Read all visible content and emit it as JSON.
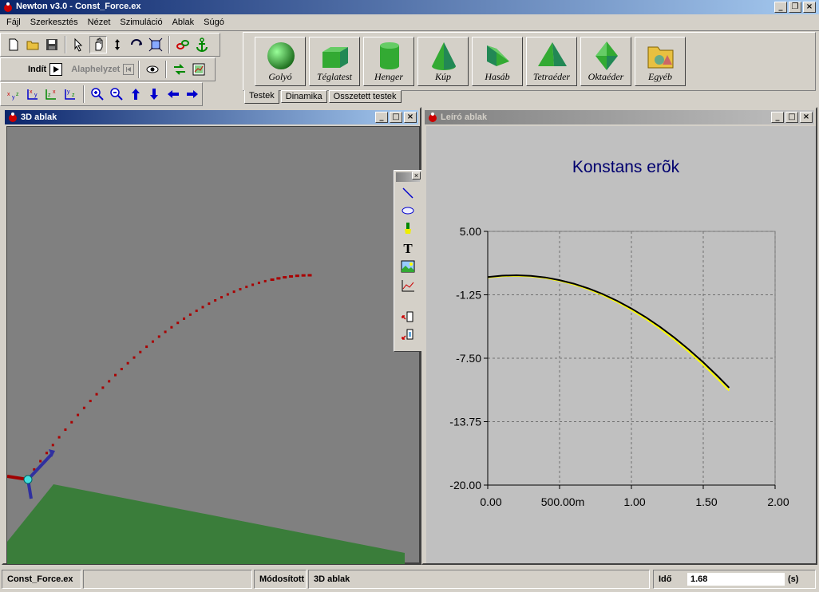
{
  "window": {
    "title": "Newton v3.0 - Const_Force.ex"
  },
  "menu": [
    "Fájl",
    "Szerkesztés",
    "Nézet",
    "Szimuláció",
    "Ablak",
    "Súgó"
  ],
  "toolbar": {
    "start_label": "Indít",
    "reset_label": "Alaphelyzet"
  },
  "palette": {
    "items": [
      {
        "label": "Golyó",
        "icon": "sphere-icon"
      },
      {
        "label": "Téglatest",
        "icon": "box-icon"
      },
      {
        "label": "Henger",
        "icon": "cylinder-icon"
      },
      {
        "label": "Kúp",
        "icon": "cone-icon"
      },
      {
        "label": "Hasáb",
        "icon": "prism-icon"
      },
      {
        "label": "Tetraéder",
        "icon": "tetrahedron-icon"
      },
      {
        "label": "Oktaéder",
        "icon": "octahedron-icon"
      },
      {
        "label": "Egyéb",
        "icon": "folder-icon"
      }
    ],
    "tabs": [
      "Testek",
      "Dinamika",
      "Osszetett testek"
    ],
    "active_tab": "Testek"
  },
  "view3d": {
    "title": "3D ablak"
  },
  "descriptor": {
    "title": "Leíró ablak"
  },
  "chart_data": {
    "type": "line",
    "title": "Konstans erõk",
    "xlabel": "",
    "ylabel": "",
    "xlim": [
      0,
      2
    ],
    "ylim": [
      -20,
      5
    ],
    "x_ticks": [
      "0.00",
      "500.00m",
      "1.00",
      "1.50",
      "2.00"
    ],
    "y_ticks": [
      "5.00",
      "-1.25",
      "-7.50",
      "-13.75",
      "-20.00"
    ],
    "grid": true,
    "series": [
      {
        "color": "#000000",
        "x": [
          0,
          0.1,
          0.2,
          0.3,
          0.4,
          0.5,
          0.6,
          0.7,
          0.8,
          0.9,
          1.0,
          1.1,
          1.2,
          1.3,
          1.4,
          1.5,
          1.6,
          1.68
        ],
        "y": [
          0.5,
          0.64,
          0.68,
          0.62,
          0.46,
          0.2,
          -0.16,
          -0.62,
          -1.18,
          -1.84,
          -2.6,
          -3.46,
          -4.42,
          -5.48,
          -6.64,
          -7.9,
          -9.26,
          -10.4
        ]
      },
      {
        "color": "#ffff00",
        "x": [
          0,
          0.1,
          0.2,
          0.3,
          0.4,
          0.5,
          0.6,
          0.7,
          0.8,
          0.9,
          1.0,
          1.1,
          1.2,
          1.3,
          1.4,
          1.5,
          1.6,
          1.68
        ],
        "y": [
          0.45,
          0.58,
          0.62,
          0.56,
          0.4,
          0.13,
          -0.24,
          -0.71,
          -1.28,
          -1.96,
          -2.74,
          -3.62,
          -4.6,
          -5.68,
          -6.86,
          -8.14,
          -9.52,
          -10.68
        ]
      }
    ]
  },
  "status": {
    "file": "Const_Force.ex",
    "modified": "Módosított",
    "active_window": "3D ablak",
    "time_label": "Idő",
    "time_value": "1.68",
    "time_unit": "(s)"
  },
  "colors": {
    "title_active": "#0a246a",
    "title_inactive": "#808080",
    "ground": "#3a7d3a",
    "trajectory": "#aa0000",
    "chart_title": "#00006e"
  }
}
